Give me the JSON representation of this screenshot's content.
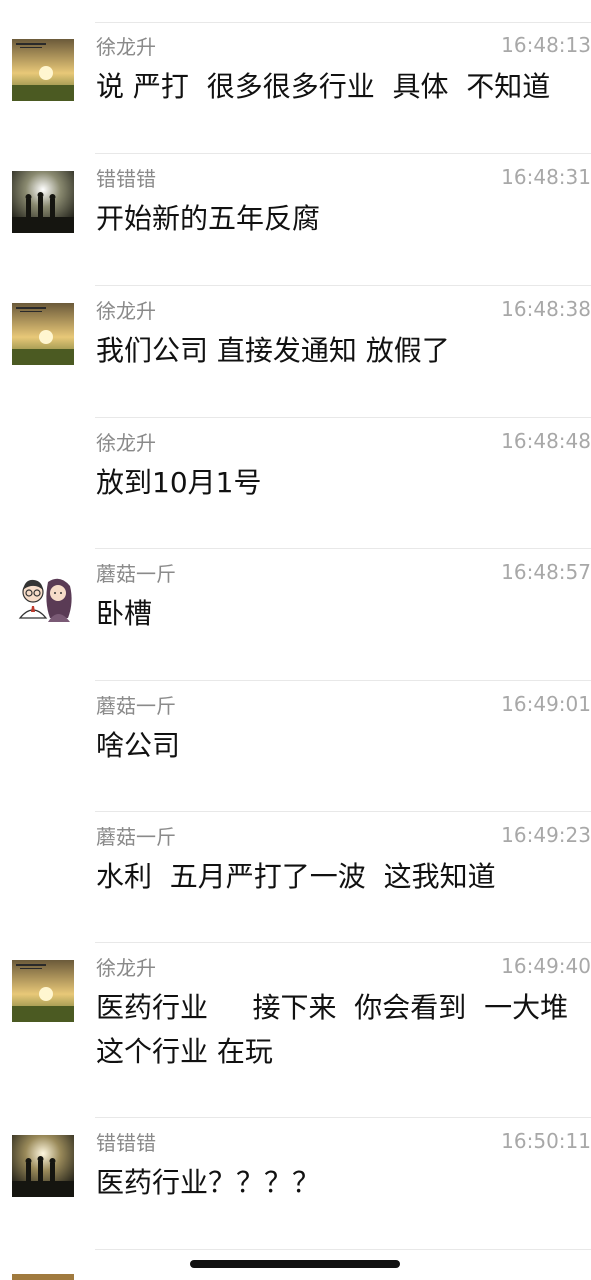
{
  "messages": [
    {
      "sender": "徐龙升",
      "time": "16:48:13",
      "text": "说 严打  很多很多行业  具体  不知道",
      "avatar": "sunset-field-avatar"
    },
    {
      "sender": "错错错",
      "time": "16:48:31",
      "text": "开始新的五年反腐",
      "avatar": "concert-crowd-avatar"
    },
    {
      "sender": "徐龙升",
      "time": "16:48:38",
      "text": "我们公司 直接发通知 放假了",
      "avatar": "sunset-field-avatar"
    },
    {
      "sender": "徐龙升",
      "time": "16:48:48",
      "text": "放到10月1号",
      "avatar": null
    },
    {
      "sender": "蘑菇一斤",
      "time": "16:48:57",
      "text": "卧槽",
      "avatar": "cartoon-couple-avatar"
    },
    {
      "sender": "蘑菇一斤",
      "time": "16:49:01",
      "text": "啥公司",
      "avatar": null
    },
    {
      "sender": "蘑菇一斤",
      "time": "16:49:23",
      "text": "水利  五月严打了一波  这我知道",
      "avatar": null
    },
    {
      "sender": "徐龙升",
      "time": "16:49:40",
      "text": "医药行业     接下来  你会看到  一大堆\n这个行业 在玩",
      "avatar": "sunset-field-avatar"
    },
    {
      "sender": "错错错",
      "time": "16:50:11",
      "text": "医药行业？？？？",
      "avatar": "concert-crowd-avatar"
    }
  ]
}
